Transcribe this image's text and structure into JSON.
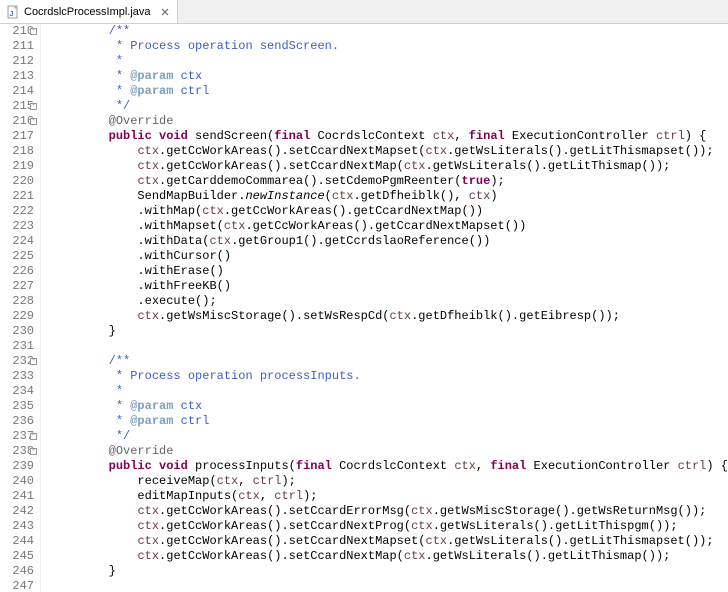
{
  "tab": {
    "filename": "CocrdslcProcessImpl.java",
    "close_tooltip": "Close"
  },
  "gutter": {
    "start": 210,
    "end": 247,
    "fold_lines": [
      210,
      215,
      216,
      232,
      237,
      238
    ]
  },
  "lines": [
    {
      "n": 210,
      "indent": 2,
      "tokens": [
        [
          "c-com",
          "/**"
        ]
      ]
    },
    {
      "n": 211,
      "indent": 2,
      "tokens": [
        [
          "c-com",
          " * Process operation sendScreen."
        ]
      ]
    },
    {
      "n": 212,
      "indent": 2,
      "tokens": [
        [
          "c-com",
          " *"
        ]
      ]
    },
    {
      "n": 213,
      "indent": 2,
      "tokens": [
        [
          "c-com",
          " * "
        ],
        [
          "c-tag",
          "@param"
        ],
        [
          "c-com",
          " ctx"
        ]
      ]
    },
    {
      "n": 214,
      "indent": 2,
      "tokens": [
        [
          "c-com",
          " * "
        ],
        [
          "c-tag",
          "@param"
        ],
        [
          "c-com",
          " ctrl"
        ]
      ]
    },
    {
      "n": 215,
      "indent": 2,
      "tokens": [
        [
          "c-com",
          " */"
        ]
      ]
    },
    {
      "n": 216,
      "indent": 2,
      "tokens": [
        [
          "c-ann",
          "@Override"
        ]
      ]
    },
    {
      "n": 217,
      "indent": 2,
      "tokens": [
        [
          "c-kw",
          "public void"
        ],
        [
          "",
          " sendScreen("
        ],
        [
          "c-kw",
          "final"
        ],
        [
          "",
          " CocrdslcContext "
        ],
        [
          "c-param",
          "ctx"
        ],
        [
          "",
          ", "
        ],
        [
          "c-kw",
          "final"
        ],
        [
          "",
          " ExecutionController "
        ],
        [
          "c-param",
          "ctrl"
        ],
        [
          "",
          ") {"
        ]
      ]
    },
    {
      "n": 218,
      "indent": 3,
      "tokens": [
        [
          "c-param",
          "ctx"
        ],
        [
          "",
          ".getCcWorkAreas().setCcardNextMapset("
        ],
        [
          "c-param",
          "ctx"
        ],
        [
          "",
          ".getWsLiterals().getLitThismapset());"
        ]
      ]
    },
    {
      "n": 219,
      "indent": 3,
      "tokens": [
        [
          "c-param",
          "ctx"
        ],
        [
          "",
          ".getCcWorkAreas().setCcardNextMap("
        ],
        [
          "c-param",
          "ctx"
        ],
        [
          "",
          ".getWsLiterals().getLitThismap());"
        ]
      ]
    },
    {
      "n": 220,
      "indent": 3,
      "tokens": [
        [
          "c-param",
          "ctx"
        ],
        [
          "",
          ".getCarddemoCommarea().setCdemoPgmReenter("
        ],
        [
          "c-kw",
          "true"
        ],
        [
          "",
          ");"
        ]
      ]
    },
    {
      "n": 221,
      "indent": 3,
      "tokens": [
        [
          "",
          "SendMapBuilder."
        ],
        [
          "c-static",
          "newInstance"
        ],
        [
          "",
          "("
        ],
        [
          "c-param",
          "ctx"
        ],
        [
          "",
          ".getDfheiblk(), "
        ],
        [
          "c-param",
          "ctx"
        ],
        [
          "",
          ")"
        ]
      ]
    },
    {
      "n": 222,
      "indent": 3,
      "tokens": [
        [
          "",
          ".withMap("
        ],
        [
          "c-param",
          "ctx"
        ],
        [
          "",
          ".getCcWorkAreas().getCcardNextMap())"
        ]
      ]
    },
    {
      "n": 223,
      "indent": 3,
      "tokens": [
        [
          "",
          ".withMapset("
        ],
        [
          "c-param",
          "ctx"
        ],
        [
          "",
          ".getCcWorkAreas().getCcardNextMapset())"
        ]
      ]
    },
    {
      "n": 224,
      "indent": 3,
      "tokens": [
        [
          "",
          ".withData("
        ],
        [
          "c-param",
          "ctx"
        ],
        [
          "",
          ".getGroup1().getCcrdslaoReference())"
        ]
      ]
    },
    {
      "n": 225,
      "indent": 3,
      "tokens": [
        [
          "",
          ".withCursor()"
        ]
      ]
    },
    {
      "n": 226,
      "indent": 3,
      "tokens": [
        [
          "",
          ".withErase()"
        ]
      ]
    },
    {
      "n": 227,
      "indent": 3,
      "tokens": [
        [
          "",
          ".withFreeKB()"
        ]
      ]
    },
    {
      "n": 228,
      "indent": 3,
      "tokens": [
        [
          "",
          ".execute();"
        ]
      ]
    },
    {
      "n": 229,
      "indent": 3,
      "tokens": [
        [
          "c-param",
          "ctx"
        ],
        [
          "",
          ".getWsMiscStorage().setWsRespCd("
        ],
        [
          "c-param",
          "ctx"
        ],
        [
          "",
          ".getDfheiblk().getEibresp());"
        ]
      ]
    },
    {
      "n": 230,
      "indent": 2,
      "tokens": [
        [
          "",
          "}"
        ]
      ]
    },
    {
      "n": 231,
      "indent": 0,
      "tokens": [
        [
          "",
          ""
        ]
      ]
    },
    {
      "n": 232,
      "indent": 2,
      "tokens": [
        [
          "c-com",
          "/**"
        ]
      ]
    },
    {
      "n": 233,
      "indent": 2,
      "tokens": [
        [
          "c-com",
          " * Process operation processInputs."
        ]
      ]
    },
    {
      "n": 234,
      "indent": 2,
      "tokens": [
        [
          "c-com",
          " *"
        ]
      ]
    },
    {
      "n": 235,
      "indent": 2,
      "tokens": [
        [
          "c-com",
          " * "
        ],
        [
          "c-tag",
          "@param"
        ],
        [
          "c-com",
          " ctx"
        ]
      ]
    },
    {
      "n": 236,
      "indent": 2,
      "tokens": [
        [
          "c-com",
          " * "
        ],
        [
          "c-tag",
          "@param"
        ],
        [
          "c-com",
          " ctrl"
        ]
      ]
    },
    {
      "n": 237,
      "indent": 2,
      "tokens": [
        [
          "c-com",
          " */"
        ]
      ]
    },
    {
      "n": 238,
      "indent": 2,
      "tokens": [
        [
          "c-ann",
          "@Override"
        ]
      ]
    },
    {
      "n": 239,
      "indent": 2,
      "tokens": [
        [
          "c-kw",
          "public void"
        ],
        [
          "",
          " processInputs("
        ],
        [
          "c-kw",
          "final"
        ],
        [
          "",
          " CocrdslcContext "
        ],
        [
          "c-param",
          "ctx"
        ],
        [
          "",
          ", "
        ],
        [
          "c-kw",
          "final"
        ],
        [
          "",
          " ExecutionController "
        ],
        [
          "c-param",
          "ctrl"
        ],
        [
          "",
          ") {"
        ]
      ]
    },
    {
      "n": 240,
      "indent": 3,
      "tokens": [
        [
          "",
          "receiveMap("
        ],
        [
          "c-param",
          "ctx"
        ],
        [
          "",
          ", "
        ],
        [
          "c-param",
          "ctrl"
        ],
        [
          "",
          ");"
        ]
      ]
    },
    {
      "n": 241,
      "indent": 3,
      "tokens": [
        [
          "",
          "editMapInputs("
        ],
        [
          "c-param",
          "ctx"
        ],
        [
          "",
          ", "
        ],
        [
          "c-param",
          "ctrl"
        ],
        [
          "",
          ");"
        ]
      ]
    },
    {
      "n": 242,
      "indent": 3,
      "tokens": [
        [
          "c-param",
          "ctx"
        ],
        [
          "",
          ".getCcWorkAreas().setCcardErrorMsg("
        ],
        [
          "c-param",
          "ctx"
        ],
        [
          "",
          ".getWsMiscStorage().getWsReturnMsg());"
        ]
      ]
    },
    {
      "n": 243,
      "indent": 3,
      "tokens": [
        [
          "c-param",
          "ctx"
        ],
        [
          "",
          ".getCcWorkAreas().setCcardNextProg("
        ],
        [
          "c-param",
          "ctx"
        ],
        [
          "",
          ".getWsLiterals().getLitThispgm());"
        ]
      ]
    },
    {
      "n": 244,
      "indent": 3,
      "tokens": [
        [
          "c-param",
          "ctx"
        ],
        [
          "",
          ".getCcWorkAreas().setCcardNextMapset("
        ],
        [
          "c-param",
          "ctx"
        ],
        [
          "",
          ".getWsLiterals().getLitThismapset());"
        ]
      ]
    },
    {
      "n": 245,
      "indent": 3,
      "tokens": [
        [
          "c-param",
          "ctx"
        ],
        [
          "",
          ".getCcWorkAreas().setCcardNextMap("
        ],
        [
          "c-param",
          "ctx"
        ],
        [
          "",
          ".getWsLiterals().getLitThismap());"
        ]
      ]
    },
    {
      "n": 246,
      "indent": 2,
      "tokens": [
        [
          "",
          "}"
        ]
      ]
    },
    {
      "n": 247,
      "indent": 0,
      "tokens": [
        [
          "",
          ""
        ]
      ]
    }
  ]
}
